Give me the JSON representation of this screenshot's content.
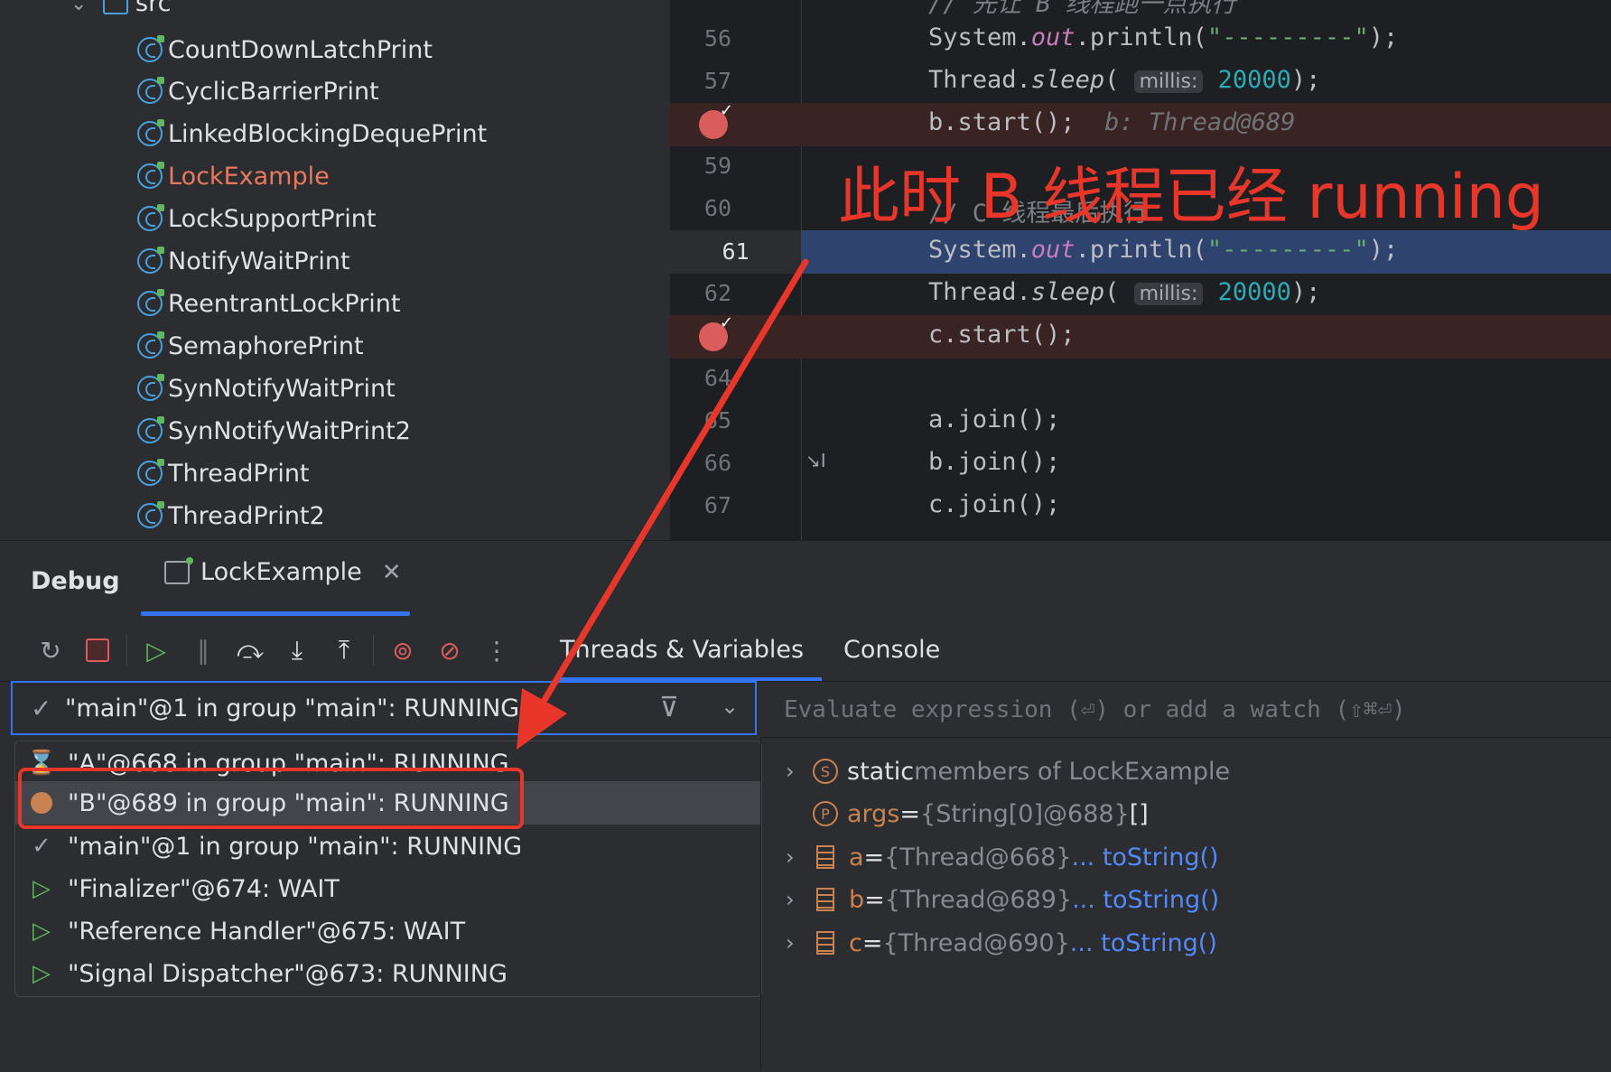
{
  "tree": {
    "folder_label": "src",
    "items": [
      {
        "label": "CountDownLatchPrint",
        "highlight": false
      },
      {
        "label": "CyclicBarrierPrint",
        "highlight": false
      },
      {
        "label": "LinkedBlockingDequePrint",
        "highlight": false
      },
      {
        "label": "LockExample",
        "highlight": true
      },
      {
        "label": "LockSupportPrint",
        "highlight": false
      },
      {
        "label": "NotifyWaitPrint",
        "highlight": false
      },
      {
        "label": "ReentrantLockPrint",
        "highlight": false
      },
      {
        "label": "SemaphorePrint",
        "highlight": false
      },
      {
        "label": "SynNotifyWaitPrint",
        "highlight": false
      },
      {
        "label": "SynNotifyWaitPrint2",
        "highlight": false
      },
      {
        "label": "ThreadPrint",
        "highlight": false
      },
      {
        "label": "ThreadPrint2",
        "highlight": false
      }
    ]
  },
  "editor": {
    "top_partial_comment": "// 先让 B 线程跑一点执行",
    "lines": {
      "l56": {
        "num": "56"
      },
      "l57": {
        "num": "57"
      },
      "l59": {
        "num": "59"
      },
      "l60": {
        "num": "60",
        "comment": "// C 线程最后执行"
      },
      "l61": {
        "num": "61"
      },
      "l62": {
        "num": "62"
      },
      "l64": {
        "num": "64"
      },
      "l65": {
        "num": "65"
      },
      "l66": {
        "num": "66"
      },
      "l67": {
        "num": "67"
      }
    },
    "code": {
      "println_prefix": "System.",
      "out": "out",
      "println_mid": ".println(",
      "dashes": "\"---------\"",
      "close": ");",
      "thread_prefix": "Thread.",
      "sleep": "sleep",
      "open": "(",
      "hint_label": "millis:",
      "sleep_value": "20000",
      "b_start": "b.start();",
      "b_inline_value": "b: Thread@689",
      "c_start": "c.start();",
      "a_join": "a.join();",
      "b_join": "b.join();",
      "c_join": "c.join();"
    }
  },
  "annotation_text": "此时 B 线程已经 running",
  "debug": {
    "title": "Debug",
    "run_tab_label": "LockExample",
    "tabs": {
      "threads": "Threads & Variables",
      "console": "Console"
    },
    "selected_thread": "\"main\"@1 in group \"main\": RUNNING",
    "threads": [
      {
        "label": "\"A\"@668 in group \"main\": RUNNING",
        "icon": "hourglass-icon"
      },
      {
        "label": "\"B\"@689 in group \"main\": RUNNING",
        "icon": "suspended-circle-icon"
      },
      {
        "label": "\"main\"@1 in group \"main\": RUNNING",
        "icon": "check-icon"
      },
      {
        "label": "\"Finalizer\"@674: WAIT",
        "icon": "play-icon"
      },
      {
        "label": "\"Reference Handler\"@675: WAIT",
        "icon": "play-icon"
      },
      {
        "label": "\"Signal Dispatcher\"@673: RUNNING",
        "icon": "play-icon"
      }
    ],
    "eval_placeholder": "Evaluate expression (⏎) or add a watch (⇧⌘⏎)",
    "variables": {
      "static": {
        "name": "static",
        "rest": " members of LockExample",
        "icon_letter": "S"
      },
      "args": {
        "name": "args",
        "eq": " = ",
        "value": "{String[0]@688}",
        "extra": " []",
        "icon_letter": "P"
      },
      "a": {
        "name": "a",
        "eq": " = ",
        "value": "{Thread@668}",
        "link": " ... toString()"
      },
      "b": {
        "name": "b",
        "eq": " = ",
        "value": "{Thread@689}",
        "link": " ... toString()"
      },
      "c": {
        "name": "c",
        "eq": " = ",
        "value": "{Thread@690}",
        "link": " ... toString()"
      }
    }
  },
  "colors": {
    "accent": "#3574f0",
    "annotation_red": "#e8372a",
    "breakpoint": "#db5c5c"
  }
}
